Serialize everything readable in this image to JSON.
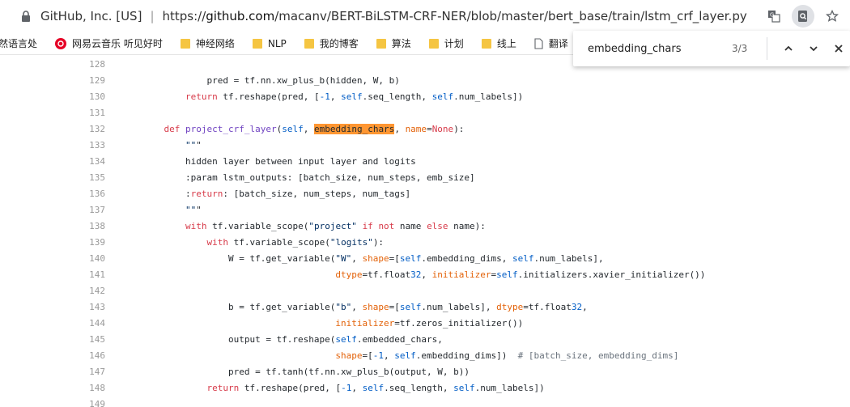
{
  "browser": {
    "site_label": "GitHub, Inc. [US]",
    "separator": "|",
    "url_prefix": "https://",
    "url_domain": "github.com",
    "url_path": "/macanv/BERT-BiLSTM-CRF-NER/blob/master/bert_base/train/lstm_crf_layer.py"
  },
  "bookmarks": [
    {
      "label": "然语言处",
      "icon": "none"
    },
    {
      "label": "网易云音乐 听见好时",
      "icon": "netease-music-icon"
    },
    {
      "label": "神经网络",
      "icon": "folder-icon"
    },
    {
      "label": "NLP",
      "icon": "folder-icon"
    },
    {
      "label": "我的博客",
      "icon": "folder-icon"
    },
    {
      "label": "算法",
      "icon": "folder-icon"
    },
    {
      "label": "计划",
      "icon": "folder-icon"
    },
    {
      "label": "线上",
      "icon": "folder-icon"
    },
    {
      "label": "翻译",
      "icon": "page-icon"
    }
  ],
  "find": {
    "query": "embedding_chars",
    "count": "3/3"
  },
  "code": [
    {
      "n": "128",
      "t": ""
    },
    {
      "n": "129",
      "t": "            pred = tf.nn.xw_plus_b(hidden, W, b)"
    },
    {
      "n": "130",
      "t": "        return tf.reshape(pred, [-1, self.seq_length, self.num_labels])"
    },
    {
      "n": "131",
      "t": ""
    },
    {
      "n": "132",
      "t": "    def project_crf_layer(self, embedding_chars, name=None):"
    },
    {
      "n": "133",
      "t": "        \"\"\""
    },
    {
      "n": "134",
      "t": "        hidden layer between input layer and logits"
    },
    {
      "n": "135",
      "t": "        :param lstm_outputs: [batch_size, num_steps, emb_size]"
    },
    {
      "n": "136",
      "t": "        :return: [batch_size, num_steps, num_tags]"
    },
    {
      "n": "137",
      "t": "        \"\"\""
    },
    {
      "n": "138",
      "t": "        with tf.variable_scope(\"project\" if not name else name):"
    },
    {
      "n": "139",
      "t": "            with tf.variable_scope(\"logits\"):"
    },
    {
      "n": "140",
      "t": "                W = tf.get_variable(\"W\", shape=[self.embedding_dims, self.num_labels],"
    },
    {
      "n": "141",
      "t": "                                    dtype=tf.float32, initializer=self.initializers.xavier_initializer())"
    },
    {
      "n": "142",
      "t": ""
    },
    {
      "n": "143",
      "t": "                b = tf.get_variable(\"b\", shape=[self.num_labels], dtype=tf.float32,"
    },
    {
      "n": "144",
      "t": "                                    initializer=tf.zeros_initializer())"
    },
    {
      "n": "145",
      "t": "                output = tf.reshape(self.embedded_chars,"
    },
    {
      "n": "146",
      "t": "                                    shape=[-1, self.embedding_dims])  # [batch_size, embedding_dims]"
    },
    {
      "n": "147",
      "t": "                pred = tf.tanh(tf.nn.xw_plus_b(output, W, b))"
    },
    {
      "n": "148",
      "t": "            return tf.reshape(pred, [-1, self.seq_length, self.num_labels])"
    },
    {
      "n": "149",
      "t": ""
    }
  ]
}
